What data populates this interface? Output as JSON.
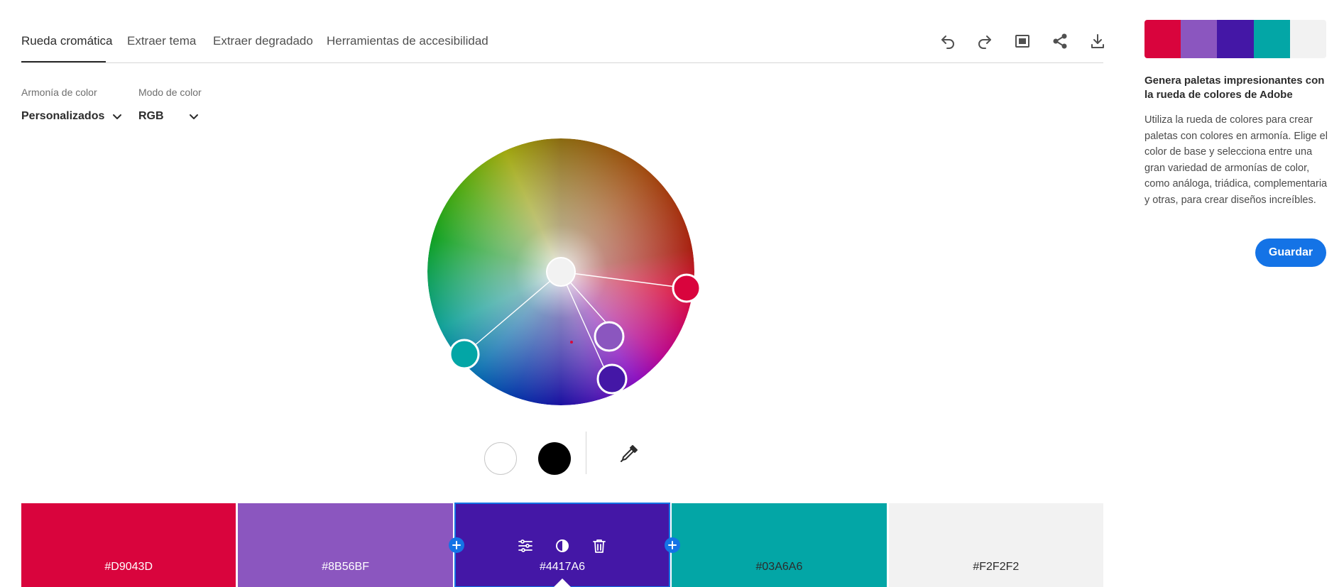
{
  "tabs": [
    {
      "label": "Rueda cromática",
      "active": true
    },
    {
      "label": "Extraer tema",
      "active": false
    },
    {
      "label": "Extraer degradado",
      "active": false
    },
    {
      "label": "Herramientas de accesibilidad",
      "active": false
    }
  ],
  "toolbar": {
    "icons": [
      "undo-icon",
      "redo-icon",
      "fullscreen-icon",
      "share-icon",
      "download-icon"
    ]
  },
  "controls": {
    "harmony_label": "Armonía de color",
    "harmony_value": "Personalizados",
    "mode_label": "Modo de color",
    "mode_value": "RGB"
  },
  "wheel": {
    "handles": [
      {
        "name": "base",
        "color": "#F2F2F2"
      },
      {
        "name": "red",
        "color": "#D9043D"
      },
      {
        "name": "purple",
        "color": "#8B56BF"
      },
      {
        "name": "indigo",
        "color": "#4417A6"
      },
      {
        "name": "teal",
        "color": "#03A6A6"
      }
    ]
  },
  "tools": {
    "white_color": "#FFFFFF",
    "black_color": "#000000",
    "eyedropper": "eyedropper-icon"
  },
  "swatches": [
    {
      "hex": "#D9043D",
      "color": "#D9043D",
      "text": "light"
    },
    {
      "hex": "#8B56BF",
      "color": "#8B56BF",
      "text": "light"
    },
    {
      "hex": "#4417A6",
      "color": "#4417A6",
      "text": "light",
      "selected": true
    },
    {
      "hex": "#03A6A6",
      "color": "#03A6A6",
      "text": "dark"
    },
    {
      "hex": "#F2F2F2",
      "color": "#F2F2F2",
      "text": "dark"
    }
  ],
  "swatch_tools": [
    "sliders-icon",
    "contrast-icon",
    "trash-icon"
  ],
  "sidebar": {
    "palette": [
      "#D9043D",
      "#8B56BF",
      "#4417A6",
      "#03A6A6",
      "#F2F2F2"
    ],
    "title": "Genera paletas impresionantes con la rueda de colores de Adobe",
    "text": "Utiliza la rueda de colores para crear paletas con colores en armonía. Elige el color de base y selecciona entre una gran variedad de armonías de color, como análoga, triádica, complementaria y otras, para crear diseños increíbles.",
    "save_label": "Guardar"
  },
  "colors": {
    "accent": "#1473e6",
    "text": "#2c2c2c"
  }
}
